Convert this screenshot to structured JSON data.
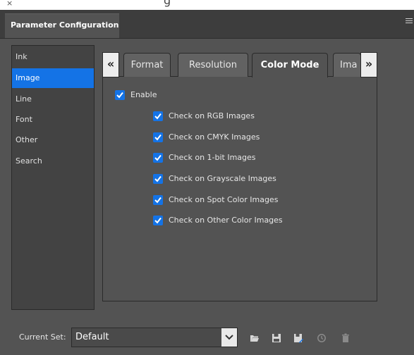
{
  "window": {
    "close_glyph": "×",
    "title_peek": "g"
  },
  "panel": {
    "tab_title": "Parameter Configuration"
  },
  "sidebar": {
    "items": [
      {
        "label": "Ink"
      },
      {
        "label": "Image",
        "active": true
      },
      {
        "label": "Line"
      },
      {
        "label": "Font"
      },
      {
        "label": "Other"
      },
      {
        "label": "Search"
      }
    ]
  },
  "tabs": {
    "prev_glyph": "«",
    "next_glyph": "»",
    "items": [
      {
        "label": "Format"
      },
      {
        "label": "Resolution"
      },
      {
        "label": "Color Mode",
        "active": true
      },
      {
        "label": "Ima"
      }
    ]
  },
  "options": {
    "enable": {
      "label": "Enable",
      "checked": true
    },
    "checks": [
      {
        "label": "Check on RGB Images",
        "checked": true
      },
      {
        "label": "Check on CMYK Images",
        "checked": true
      },
      {
        "label": "Check on 1-bit Images",
        "checked": true
      },
      {
        "label": "Check on Grayscale Images",
        "checked": true
      },
      {
        "label": "Check on Spot Color Images",
        "checked": true
      },
      {
        "label": "Check on Other Color Images",
        "checked": true
      }
    ]
  },
  "footer": {
    "label": "Current Set:",
    "current_set": "Default",
    "icons": [
      "folder-open-icon",
      "save-icon",
      "save-as-icon",
      "history-icon",
      "trash-icon"
    ]
  },
  "colors": {
    "accent": "#1473e6",
    "panel_bg": "#535353",
    "header_bg": "#3d3d3d"
  }
}
